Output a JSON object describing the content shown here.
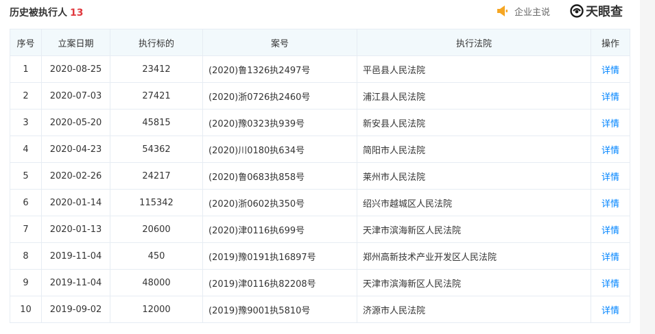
{
  "header": {
    "title": "历史被执行人",
    "count": "13",
    "enterprise_say": "企业主说",
    "brand": "天眼查"
  },
  "colors": {
    "accent_red": "#e0393e",
    "link_blue": "#0084ff",
    "header_bg": "#f2f9fc",
    "speaker_orange": "#f5a623"
  },
  "table": {
    "columns": [
      "序号",
      "立案日期",
      "执行标的",
      "案号",
      "执行法院",
      "操作"
    ],
    "rows": [
      {
        "no": "1",
        "date": "2020-08-25",
        "amount": "23412",
        "case_no": "(2020)鲁1326执2497号",
        "court": "平邑县人民法院",
        "action": "详情"
      },
      {
        "no": "2",
        "date": "2020-07-03",
        "amount": "27421",
        "case_no": "(2020)浙0726执2460号",
        "court": "浦江县人民法院",
        "action": "详情"
      },
      {
        "no": "3",
        "date": "2020-05-20",
        "amount": "45815",
        "case_no": "(2020)豫0323执939号",
        "court": "新安县人民法院",
        "action": "详情"
      },
      {
        "no": "4",
        "date": "2020-04-23",
        "amount": "54362",
        "case_no": "(2020)川0180执634号",
        "court": "简阳市人民法院",
        "action": "详情"
      },
      {
        "no": "5",
        "date": "2020-02-26",
        "amount": "24217",
        "case_no": "(2020)鲁0683执858号",
        "court": "莱州市人民法院",
        "action": "详情"
      },
      {
        "no": "6",
        "date": "2020-01-14",
        "amount": "115342",
        "case_no": "(2020)浙0602执350号",
        "court": "绍兴市越城区人民法院",
        "action": "详情"
      },
      {
        "no": "7",
        "date": "2020-01-13",
        "amount": "20600",
        "case_no": "(2020)津0116执699号",
        "court": "天津市滨海新区人民法院",
        "action": "详情"
      },
      {
        "no": "8",
        "date": "2019-11-04",
        "amount": "450",
        "case_no": "(2019)豫0191执16897号",
        "court": "郑州高新技术产业开发区人民法院",
        "action": "详情"
      },
      {
        "no": "9",
        "date": "2019-11-04",
        "amount": "48000",
        "case_no": "(2019)津0116执82208号",
        "court": "天津市滨海新区人民法院",
        "action": "详情"
      },
      {
        "no": "10",
        "date": "2019-09-02",
        "amount": "12000",
        "case_no": "(2019)豫9001执5810号",
        "court": "济源市人民法院",
        "action": "详情"
      }
    ]
  }
}
